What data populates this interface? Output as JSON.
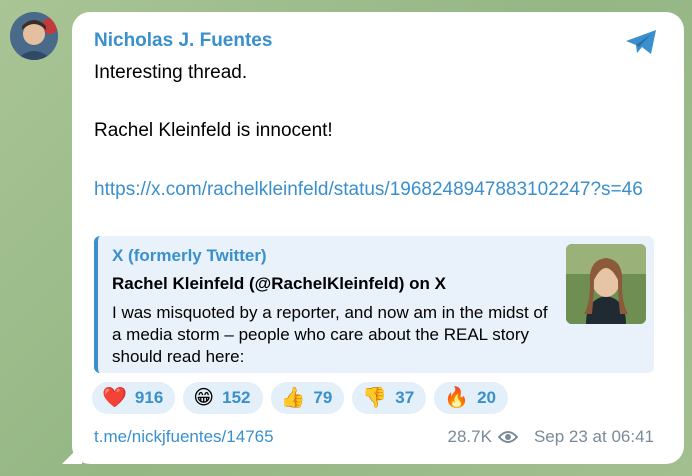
{
  "author": {
    "name": "Nicholas J. Fuentes"
  },
  "message": {
    "lines": [
      "Interesting thread.",
      "Rachel Kleinfeld is innocent!"
    ],
    "link": "https://x.com/rachelkleinfeld/status/1968248947883102247?s=46"
  },
  "preview": {
    "site": "X (formerly Twitter)",
    "title": "Rachel Kleinfeld (@RachelKleinfeld) on X",
    "description": "I was misquoted by a reporter, and now am in the midst of a media storm – people who care about the REAL story should read here:"
  },
  "reactions": [
    {
      "emoji": "❤️",
      "icon": "heart-icon",
      "count": "916"
    },
    {
      "emoji": "😁",
      "icon": "grin-icon",
      "count": "152"
    },
    {
      "emoji": "👍",
      "icon": "thumbs-up-icon",
      "count": "79"
    },
    {
      "emoji": "👎",
      "icon": "thumbs-down-icon",
      "count": "37"
    },
    {
      "emoji": "🔥",
      "icon": "fire-icon",
      "count": "20"
    }
  ],
  "footer": {
    "post_link": "t.me/nickjfuentes/14765",
    "views": "28.7K",
    "timestamp": "Sep 23 at 06:41"
  },
  "colors": {
    "accent": "#3a8fcd",
    "reaction_bg": "#e3eff9",
    "preview_bg": "#e9f2fa",
    "muted": "#7a8a9a"
  }
}
